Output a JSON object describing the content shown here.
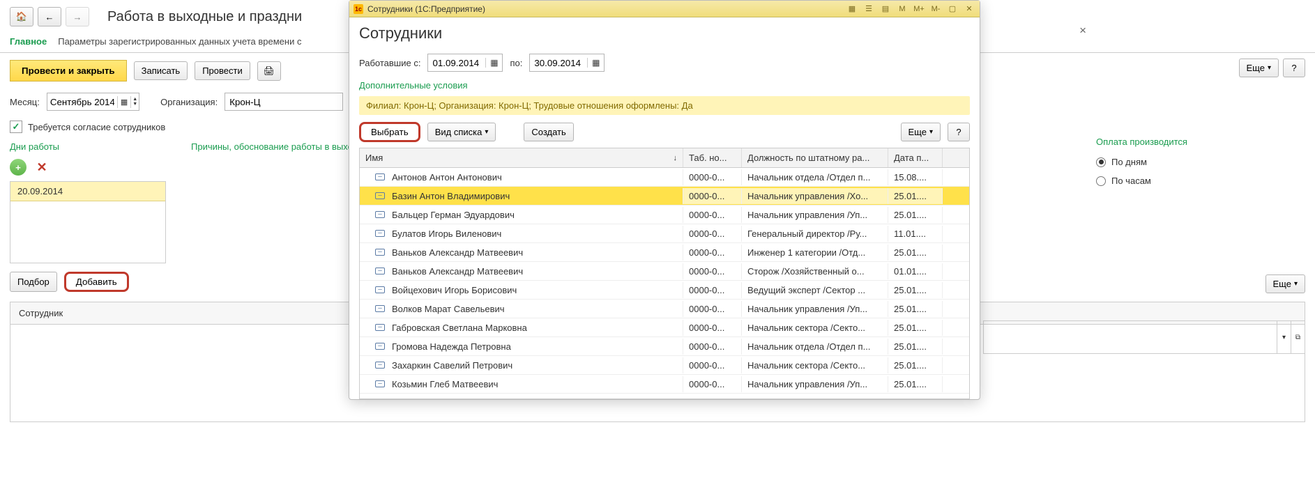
{
  "back": {
    "title": "Работа в выходные и праздни",
    "tabs": {
      "main": "Главное",
      "params": "Параметры зарегистрированных данных учета времени с"
    },
    "buttons": {
      "postClose": "Провести и закрыть",
      "save": "Записать",
      "post": "Провести",
      "more": "Еще",
      "help": "?",
      "pick": "Подбор",
      "add": "Добавить"
    },
    "monthLabel": "Месяц:",
    "monthValue": "Сентябрь 2014",
    "orgLabel": "Организация:",
    "orgValue": "Крон-Ц",
    "consent": "Требуется согласие сотрудников",
    "workdays": "Дни работы",
    "reasons": "Причины, обоснование работы в выход",
    "dateItem": "20.09.2014",
    "empHeader": "Сотрудник",
    "payHeader": "Оплата производится",
    "payByDays": "По дням",
    "payByHours": "По часам",
    "more2": "Еще"
  },
  "modal": {
    "winTitle": "Сотрудники (1С:Предприятие)",
    "tbM": "M",
    "tbMp": "M+",
    "tbMm": "M-",
    "title": "Сотрудники",
    "workedFrom": "Работавшие с:",
    "dateFrom": "01.09.2014",
    "to": "по:",
    "dateTo": "30.09.2014",
    "extraCond": "Дополнительные условия",
    "filterBar": "Филиал: Крон-Ц; Организация: Крон-Ц; Трудовые отношения оформлены: Да",
    "select": "Выбрать",
    "listView": "Вид списка",
    "create": "Создать",
    "more": "Еще",
    "help": "?",
    "cols": {
      "name": "Имя",
      "tab": "Таб. но...",
      "pos": "Должность по штатному ра...",
      "date": "Дата п..."
    },
    "rows": [
      {
        "name": "Антонов Антон Антонович",
        "tab": "0000-0...",
        "pos": "Начальник отдела /Отдел п...",
        "date": "15.08...."
      },
      {
        "name": "Базин Антон Владимирович",
        "tab": "0000-0...",
        "pos": "Начальник управления /Хо...",
        "date": "25.01...."
      },
      {
        "name": "Бальцер Герман Эдуардович",
        "tab": "0000-0...",
        "pos": "Начальник управления /Уп...",
        "date": "25.01...."
      },
      {
        "name": "Булатов Игорь Виленович",
        "tab": "0000-0...",
        "pos": "Генеральный директор /Ру...",
        "date": "11.01...."
      },
      {
        "name": "Ваньков Александр Матвеевич",
        "tab": "0000-0...",
        "pos": "Инженер 1 категории /Отд...",
        "date": "25.01...."
      },
      {
        "name": "Ваньков Александр Матвеевич",
        "tab": "0000-0...",
        "pos": "Сторож /Хозяйственный о...",
        "date": "01.01...."
      },
      {
        "name": "Войцехович Игорь Борисович",
        "tab": "0000-0...",
        "pos": "Ведущий эксперт /Сектор ...",
        "date": "25.01...."
      },
      {
        "name": "Волков Марат Савельевич",
        "tab": "0000-0...",
        "pos": "Начальник управления /Уп...",
        "date": "25.01...."
      },
      {
        "name": "Габровская Светлана Марковна",
        "tab": "0000-0...",
        "pos": "Начальник сектора /Секто...",
        "date": "25.01...."
      },
      {
        "name": "Громова Надежда Петровна",
        "tab": "0000-0...",
        "pos": "Начальник отдела /Отдел п...",
        "date": "25.01...."
      },
      {
        "name": "Захаркин Савелий Петрович",
        "tab": "0000-0...",
        "pos": "Начальник сектора /Секто...",
        "date": "25.01...."
      },
      {
        "name": "Козьмин Глеб Матвеевич",
        "tab": "0000-0...",
        "pos": "Начальник управления /Уп...",
        "date": "25.01...."
      }
    ]
  }
}
